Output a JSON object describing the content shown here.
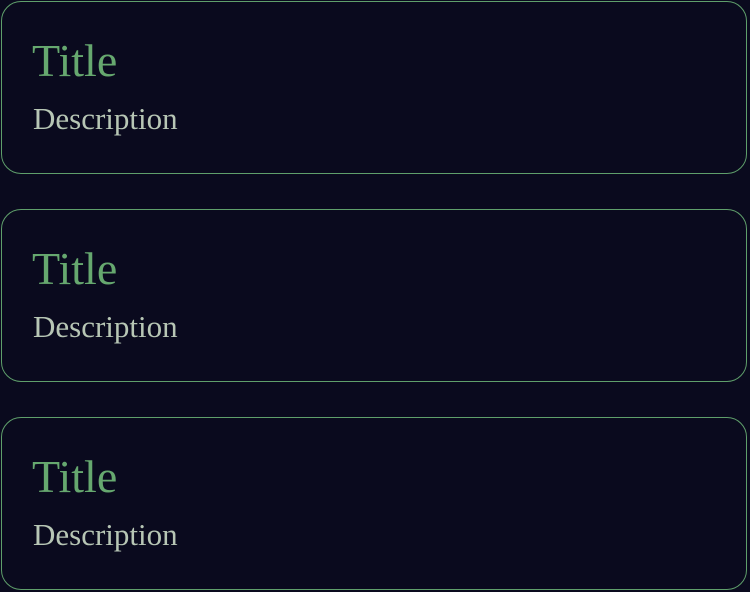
{
  "cards": [
    {
      "title": "Title",
      "description": "Description"
    },
    {
      "title": "Title",
      "description": "Description"
    },
    {
      "title": "Title",
      "description": "Description"
    }
  ],
  "colors": {
    "background": "#0a0a1e",
    "border": "#5f9f6b",
    "title": "#66a86f",
    "description": "#b7c6b5"
  }
}
